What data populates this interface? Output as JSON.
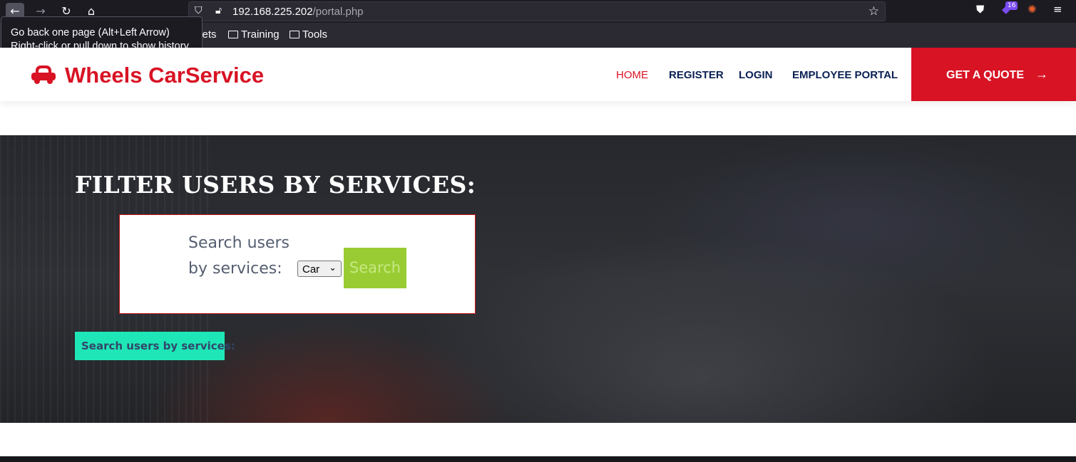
{
  "browser": {
    "url_host": "192.168.225.202",
    "url_path": "/portal.php",
    "extension_badge": "16",
    "bookmarks": [
      "heat sheets",
      "Training",
      "Tools"
    ],
    "tooltip_line1": "Go back one page (Alt+Left Arrow)",
    "tooltip_line2": "Right-click or pull down to show history"
  },
  "site": {
    "brand": "Wheels CarService",
    "brand_color": "#d81324",
    "nav": [
      "HOME",
      "REGISTER",
      "LOGIN",
      "EMPLOYEE PORTAL"
    ],
    "quote_label": "GET A QUOTE"
  },
  "hero": {
    "title": "FILTER USERS BY SERVICES:",
    "search_label_line1": "Search users",
    "search_label_line2": "by services:",
    "select_value": "Car",
    "search_button": "Search",
    "result_label": "Search users by services:"
  }
}
